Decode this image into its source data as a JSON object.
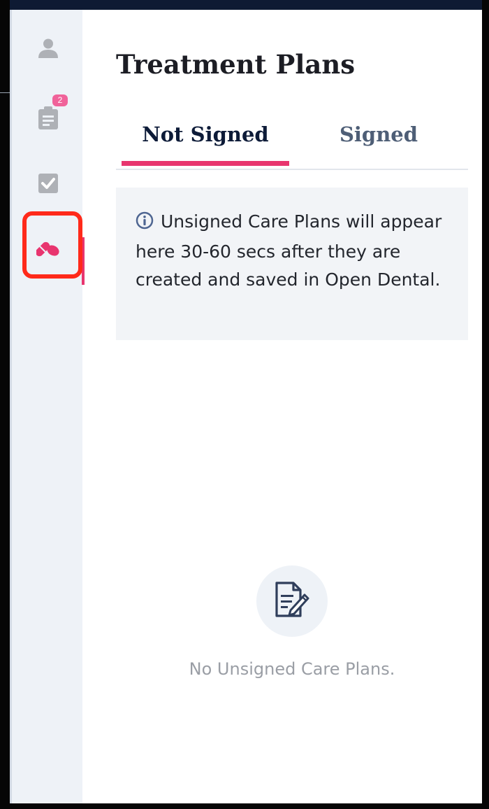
{
  "page": {
    "title": "Treatment Plans"
  },
  "sidebar": {
    "items": [
      {
        "icon": "user-icon",
        "active": false
      },
      {
        "icon": "clipboard-icon",
        "badge": "2",
        "active": false
      },
      {
        "icon": "checkbox-icon",
        "active": false
      },
      {
        "icon": "pills-icon",
        "active": true
      }
    ]
  },
  "tabs": [
    {
      "label": "Not Signed",
      "active": true
    },
    {
      "label": "Signed",
      "active": false
    }
  ],
  "info": {
    "icon": "info-icon",
    "text": "Unsigned Care Plans will appear here 30-60 secs after they are created and saved in Open Dental."
  },
  "empty_state": {
    "icon": "document-edit-icon",
    "text": "No Unsigned Care Plans."
  },
  "colors": {
    "accent": "#e8356f",
    "badge": "#f0639a",
    "highlight": "#ff2a1a",
    "sidebar_bg": "#eef2f7",
    "heading": "#1c1d24",
    "muted_icon": "#aeb1b6"
  }
}
